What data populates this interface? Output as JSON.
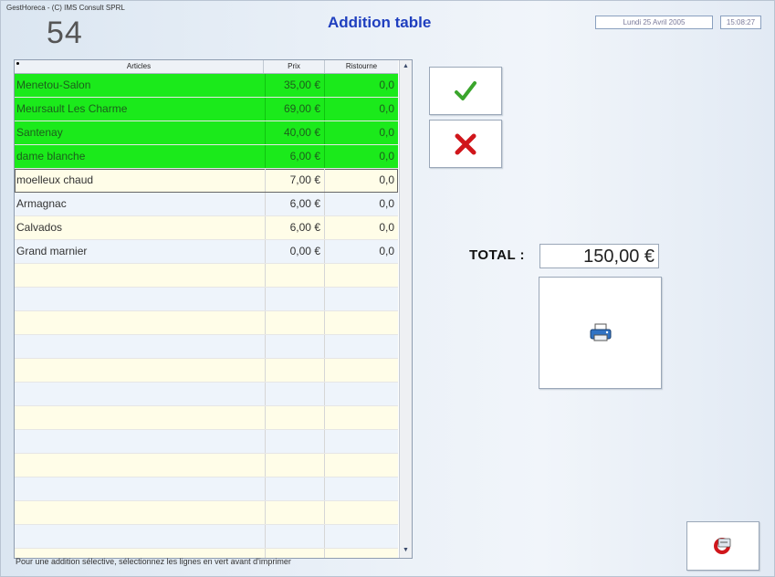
{
  "window": {
    "app_title": "GestHoreca - (C) IMS Consult SPRL",
    "table_number": "54",
    "screen_title": "Addition table",
    "date": "Lundi 25 Avril 2005",
    "time": "15:08:27"
  },
  "grid": {
    "columns": [
      "Articles",
      "Prix",
      "Ristourne"
    ],
    "rows": [
      {
        "article": "Menetou-Salon",
        "prix": "35,00 €",
        "ristourne": "0,0",
        "selected_green": true
      },
      {
        "article": "Meursault Les Charme",
        "prix": "69,00 €",
        "ristourne": "0,0",
        "selected_green": true
      },
      {
        "article": "Santenay",
        "prix": "40,00 €",
        "ristourne": "0,0",
        "selected_green": true
      },
      {
        "article": "dame blanche",
        "prix": "6,00 €",
        "ristourne": "0,0",
        "selected_green": true
      },
      {
        "article": "moelleux chaud",
        "prix": "7,00 €",
        "ristourne": "0,0",
        "selected_green": false
      },
      {
        "article": "Armagnac",
        "prix": "6,00 €",
        "ristourne": "0,0",
        "selected_green": false
      },
      {
        "article": "Calvados",
        "prix": "6,00 €",
        "ristourne": "0,0",
        "selected_green": false
      },
      {
        "article": "Grand marnier",
        "prix": "0,00 €",
        "ristourne": "0,0",
        "selected_green": false
      }
    ],
    "status_text": "Pour une addition sélective, sélectionnez les lignes en vert avant d'imprimer"
  },
  "total": {
    "label": "TOTAL :",
    "value": "150,00 €"
  },
  "icons": {
    "ok": "checkmark-icon",
    "cancel": "close-icon",
    "print": "printer-icon",
    "exit": "exit-icon"
  },
  "colors": {
    "title_blue": "#1f3fbf",
    "selected_row_green": "#1bea1b",
    "check_green": "#3aa52c",
    "cross_red": "#d0161b"
  }
}
